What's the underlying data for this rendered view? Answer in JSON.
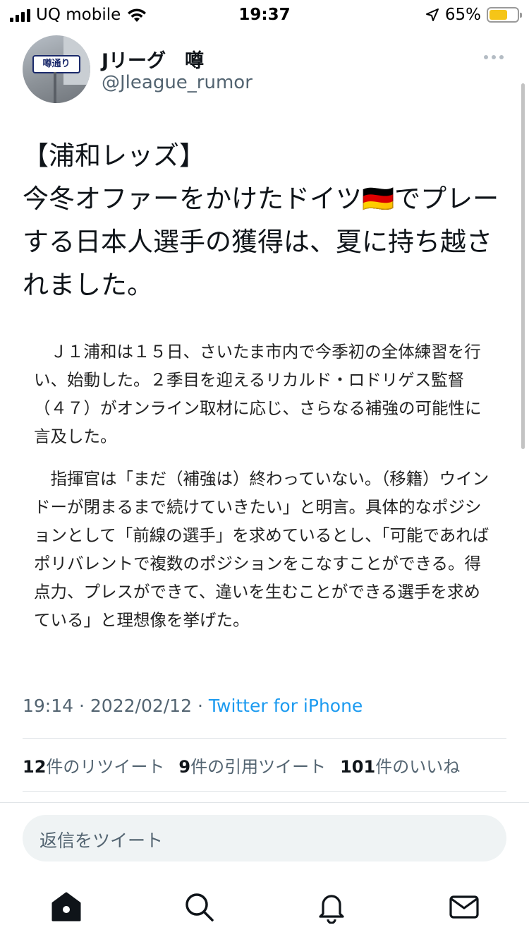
{
  "status_bar": {
    "carrier": "UQ mobile",
    "time": "19:37",
    "battery_percent": "65%",
    "battery_level": 0.65,
    "battery_color": "#f5c518"
  },
  "tweet": {
    "avatar_sign_text": "噂通り",
    "display_name": "Jリーグ　噂",
    "handle": "@Jleague_rumor",
    "more_icon": "ellipsis-icon",
    "text": "【浦和レッズ】\n今冬オファーをかけたドイツ🇩🇪でプレーする日本人選手の獲得は、夏に持ち越されました。",
    "article_paragraphs": [
      "Ｊ１浦和は１５日、さいたま市内で今季初の全体練習を行い、始動した。２季目を迎えるリカルド・ロドリゲス監督（４７）がオンライン取材に応じ、さらなる補強の可能性に言及した。",
      "指揮官は「まだ（補強は）終わっていない。（移籍）ウインドーが閉まるまで続けていきたい」と明言。具体的なポジションとして「前線の選手」を求めているとし、「可能であればポリバレントで複数のポジションをこなすことができる。得点力、プレスができて、違いを生むことができる選手を求めている」と理想像を挙げた。"
    ],
    "time": "19:14",
    "date": "2022/02/12",
    "separator": "·",
    "source": "Twitter for iPhone",
    "source_color": "#1d9bf0"
  },
  "stats": {
    "retweets_count": "12",
    "retweets_label": "件のリツイート",
    "quotes_count": "9",
    "quotes_label": "件の引用ツイート",
    "likes_count": "101",
    "likes_label": "件のいいね"
  },
  "reply": {
    "placeholder": "返信をツイート"
  },
  "tabbar": {
    "icons": [
      "home-icon",
      "search-icon",
      "notifications-icon",
      "messages-icon"
    ]
  }
}
